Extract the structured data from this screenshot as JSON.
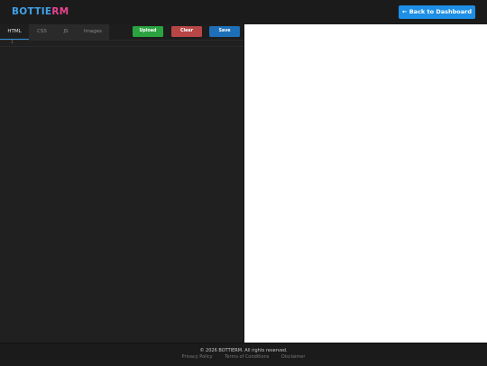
{
  "header": {
    "logo_part1": "BOTTIE",
    "logo_part2": "RM",
    "back_button": "← Back to Dashboard"
  },
  "editor": {
    "tabs": [
      "HTML",
      "CSS",
      "JS",
      "Images"
    ],
    "active_tab": "HTML",
    "buttons": {
      "upload": "Upload",
      "clear": "Clear",
      "save": "Save"
    },
    "line_number": "1"
  },
  "footer": {
    "copyright": "© 2026 BOTTIERM. All rights reserved.",
    "links": [
      "Privacy Policy",
      "Terms of Conditions",
      "Disclaimer"
    ]
  },
  "colors": {
    "logo_blue": "#3fa2e8",
    "logo_pink": "#e8458f",
    "back_button": "#1e8fe6",
    "upload": "#2ba341",
    "clear": "#b84646",
    "save": "#1d6fb8",
    "active_tab_underline": "#2f8fe0"
  }
}
